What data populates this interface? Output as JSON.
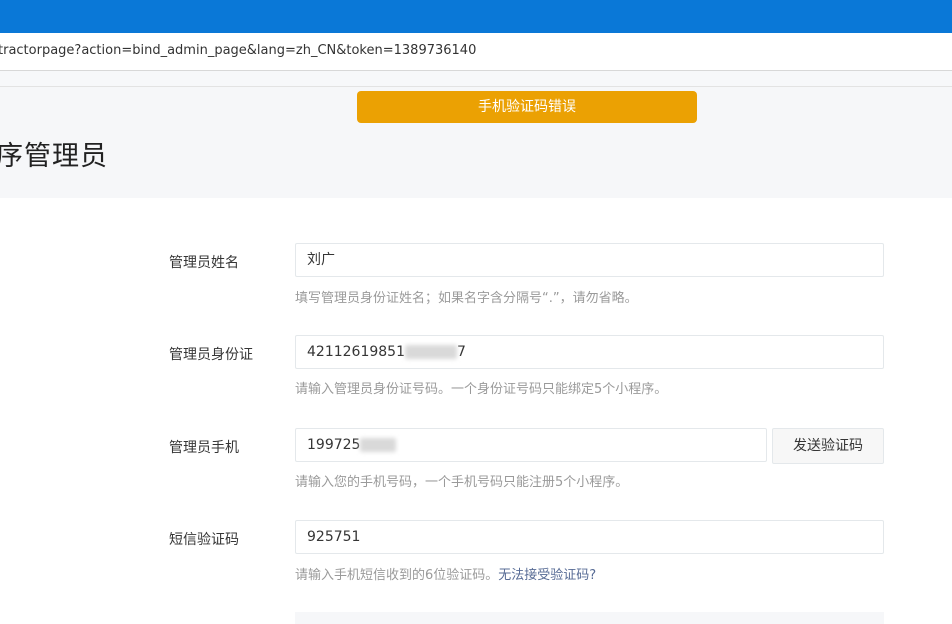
{
  "browser": {
    "url": "tractorpage?action=bind_admin_page&lang=zh_CN&token=1389736140"
  },
  "toast": {
    "message": "手机验证码错误",
    "color": "#eba103"
  },
  "page": {
    "title": "序管理员"
  },
  "form": {
    "name": {
      "label": "管理员姓名",
      "value": "刘广",
      "hint": "填写管理员身份证姓名；如果名字含分隔号“.”，请勿省略。"
    },
    "id_card": {
      "label": "管理员身份证",
      "value_prefix": "42112619851",
      "value_suffix": "7",
      "hint": "请输入管理员身份证号码。一个身份证号码只能绑定5个小程序。"
    },
    "phone": {
      "label": "管理员手机",
      "value_prefix": "199725",
      "send_button": "发送验证码",
      "hint": "请输入您的手机号码，一个手机号码只能注册5个小程序。"
    },
    "sms": {
      "label": "短信验证码",
      "value": "925751",
      "hint": "请输入手机短信收到的6位验证码。",
      "help_link": "无法接受验证码?"
    }
  },
  "colors": {
    "titlebar": "#0a78d7",
    "link": "#576b95"
  }
}
